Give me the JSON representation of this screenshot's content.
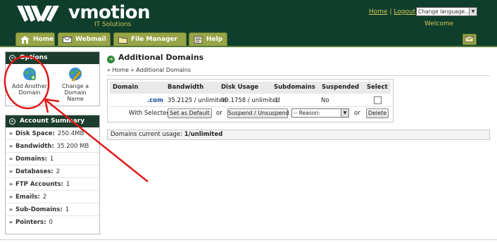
{
  "header": {
    "brand": "vmotion",
    "tagline": "IT Solutions",
    "home_link": "Home",
    "separator": "|",
    "logout_link": "Logout",
    "language_select": "Change language...",
    "welcome": "Welcome",
    "colors": {
      "header_bg": "#0f3f2c",
      "gold": "#d6c25a",
      "tab": "#97a447"
    }
  },
  "tabs": [
    {
      "label": "Home",
      "icon": "home-icon"
    },
    {
      "label": "Webmail",
      "icon": "mail-icon"
    },
    {
      "label": "File Manager",
      "icon": "folder-icon"
    },
    {
      "label": "Help",
      "icon": "help-icon"
    }
  ],
  "sidebar": {
    "options": {
      "title": "Options",
      "items": [
        {
          "line1": "Add Another",
          "line2": "Domain",
          "icon": "globe-plus-icon"
        },
        {
          "line1": "Change a Domain",
          "line2": "Name",
          "icon": "globe-edit-icon"
        }
      ]
    },
    "account": {
      "title": "Account Summary",
      "rows": [
        {
          "label": "Disk Space:",
          "value": "250.4MB"
        },
        {
          "label": "Bandwidth:",
          "value": "35.200 MB"
        },
        {
          "label": "Domains:",
          "value": "1"
        },
        {
          "label": "Databases:",
          "value": "2"
        },
        {
          "label": "FTP Accounts:",
          "value": "1"
        },
        {
          "label": "Emails:",
          "value": "2"
        },
        {
          "label": "Sub-Domains:",
          "value": "1"
        },
        {
          "label": "Pointers:",
          "value": "0"
        }
      ]
    }
  },
  "main": {
    "title": "Additional Domains",
    "breadcrumb": {
      "prefix": "»",
      "home": "Home",
      "sep": "»",
      "current": "Additional Domains"
    },
    "table": {
      "headers": [
        "Domain",
        "Bandwidth",
        "Disk Usage",
        "Subdomains",
        "Suspended",
        "Select"
      ],
      "row": {
        "domain": ".com",
        "bandwidth": "35.2125 / unlimited",
        "disk": "99.1758 / unlimited",
        "subdomains": "1",
        "suspended": "No"
      },
      "actions": {
        "with_selected": "With Selected",
        "set_default": "Set as Default",
        "or1": "or",
        "suspend": "Suspend / Unsuspend",
        "reason": "-- Reason:",
        "or2": "or",
        "delete": "Delete"
      }
    },
    "usage": {
      "label": "Domains current usage:",
      "value": "1/unlimited"
    }
  }
}
